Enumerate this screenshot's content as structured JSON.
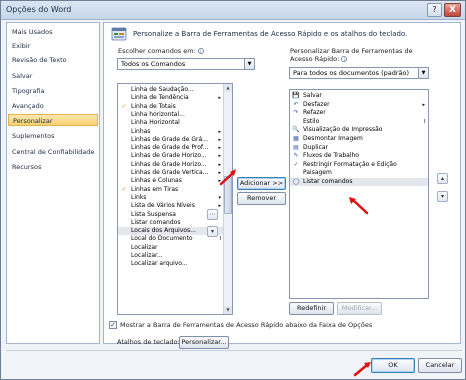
{
  "window": {
    "title": "Opções do Word",
    "help_glyph": "?",
    "close_glyph": "X"
  },
  "sidebar": {
    "items": [
      {
        "label": "Mais Usados"
      },
      {
        "label": "Exibir"
      },
      {
        "label": "Revisão de Texto"
      },
      {
        "label": "Salvar"
      },
      {
        "label": "Tipografia"
      },
      {
        "label": "Avançado"
      },
      {
        "label": "Personalizar"
      },
      {
        "label": "Suplementos"
      },
      {
        "label": "Central de Confiabilidade"
      },
      {
        "label": "Recursos"
      }
    ],
    "selected": "Personalizar"
  },
  "header": {
    "text": "Personalize a Barra de Ferramentas de Acesso Rápido e os atalhos do teclado."
  },
  "left_panel": {
    "label": "Escolher comandos em:",
    "dropdown_value": "Todos os Comandos",
    "items": [
      {
        "icon": "",
        "label": "Linha de Saudação...",
        "sub": ""
      },
      {
        "icon": "",
        "label": "Linha de Tendência",
        "sub": "▸"
      },
      {
        "icon": "✓",
        "label": "Linha de Totais",
        "sub": ""
      },
      {
        "icon": "",
        "label": "Linha horizontal...",
        "sub": ""
      },
      {
        "icon": "",
        "label": "Linha Horizontal",
        "sub": ""
      },
      {
        "icon": "",
        "label": "Linhas",
        "sub": "▸"
      },
      {
        "icon": "",
        "label": "Linhas de Grade de Grá...",
        "sub": "▸"
      },
      {
        "icon": "",
        "label": "Linhas de Grade de Prof...",
        "sub": "▸"
      },
      {
        "icon": "",
        "label": "Linhas de Grade Horizo...",
        "sub": "▸"
      },
      {
        "icon": "",
        "label": "Linhas de Grade Horizo...",
        "sub": "▸"
      },
      {
        "icon": "",
        "label": "Linhas de Grade Vertica...",
        "sub": "▸"
      },
      {
        "icon": "",
        "label": "Linhas e Colunas",
        "sub": "▸"
      },
      {
        "icon": "✓",
        "label": "Linhas em Tiras",
        "sub": ""
      },
      {
        "icon": "",
        "label": "Links",
        "sub": "▾"
      },
      {
        "icon": "",
        "label": "Lista de Vários Níveis",
        "sub": "▸"
      },
      {
        "icon": "",
        "label": "Lista Suspensa",
        "sub": ""
      },
      {
        "icon": "",
        "label": "Listar comandos",
        "sub": ""
      },
      {
        "icon": "",
        "label": "Locais dos Arquivos...",
        "sub": ""
      },
      {
        "icon": "",
        "label": "Local do Documento",
        "sub": "I"
      },
      {
        "icon": "",
        "label": "Localizar",
        "sub": ""
      },
      {
        "icon": "",
        "label": "Localizar...",
        "sub": ""
      },
      {
        "icon": "",
        "label": "Localizar arquivo...",
        "sub": ""
      }
    ],
    "highlighted_index": 17,
    "small_buttons": [
      "⋯",
      "▾"
    ]
  },
  "middle": {
    "add_label": "Adicionar >>",
    "remove_label": "Remover"
  },
  "right_panel": {
    "label": "Personalizar Barra de Ferramentas de Acesso Rápido:",
    "dropdown_value": "Para todos os documentos (padrão)",
    "items": [
      {
        "icon": "💾",
        "label": "Salvar",
        "sub": ""
      },
      {
        "icon": "↶",
        "label": "Desfazer",
        "sub": "▸"
      },
      {
        "icon": "↷",
        "label": "Refazer",
        "sub": ""
      },
      {
        "icon": "",
        "label": "Estilo",
        "sub": "I"
      },
      {
        "icon": "🔍",
        "label": "Visualização de Impressão",
        "sub": ""
      },
      {
        "icon": "▦",
        "label": "Desmontar Imagem",
        "sub": ""
      },
      {
        "icon": "▤",
        "label": "Duplicar",
        "sub": ""
      },
      {
        "icon": "✎",
        "label": "Fluxos de Trabalho",
        "sub": ""
      },
      {
        "icon": "✓",
        "label": "Restringir Formatação e Edição",
        "sub": ""
      },
      {
        "icon": "",
        "label": "Paisagem",
        "sub": ""
      },
      {
        "icon": "◯",
        "label": "Listar comandos",
        "sub": ""
      }
    ],
    "highlighted_index": 10,
    "reset_label": "Redefinir",
    "modify_label": "Modificar...",
    "side_buttons": [
      "▴",
      "▾"
    ]
  },
  "checkbox_option": {
    "label": "Mostrar a Barra de Ferramentas de Acesso Rápido abaixo da Faixa de Opções",
    "checked": "✓"
  },
  "keyboard": {
    "label": "Atalhos de teclado:",
    "button_label": "Personalizar..."
  },
  "footer": {
    "ok_label": "OK",
    "cancel_label": "Cancelar"
  }
}
